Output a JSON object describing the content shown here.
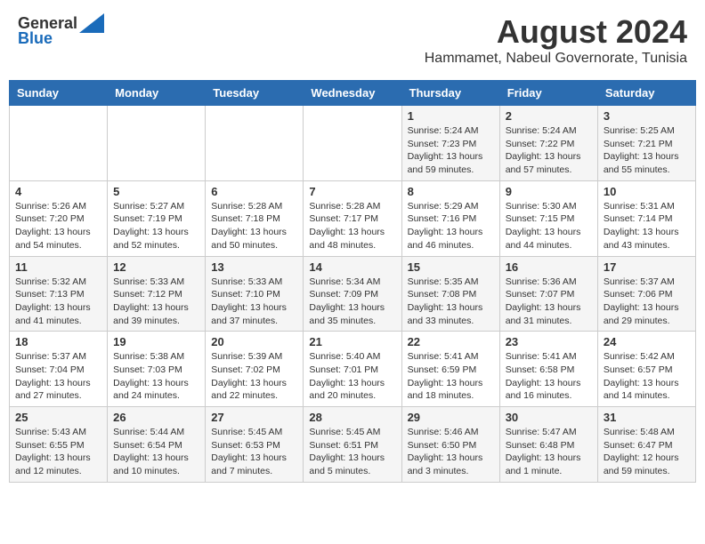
{
  "header": {
    "logo_general": "General",
    "logo_blue": "Blue",
    "month_year": "August 2024",
    "location": "Hammamet, Nabeul Governorate, Tunisia"
  },
  "weekdays": [
    "Sunday",
    "Monday",
    "Tuesday",
    "Wednesday",
    "Thursday",
    "Friday",
    "Saturday"
  ],
  "weeks": [
    [
      {
        "day": "",
        "info": ""
      },
      {
        "day": "",
        "info": ""
      },
      {
        "day": "",
        "info": ""
      },
      {
        "day": "",
        "info": ""
      },
      {
        "day": "1",
        "sunrise": "Sunrise: 5:24 AM",
        "sunset": "Sunset: 7:23 PM",
        "daylight": "Daylight: 13 hours and 59 minutes."
      },
      {
        "day": "2",
        "sunrise": "Sunrise: 5:24 AM",
        "sunset": "Sunset: 7:22 PM",
        "daylight": "Daylight: 13 hours and 57 minutes."
      },
      {
        "day": "3",
        "sunrise": "Sunrise: 5:25 AM",
        "sunset": "Sunset: 7:21 PM",
        "daylight": "Daylight: 13 hours and 55 minutes."
      }
    ],
    [
      {
        "day": "4",
        "sunrise": "Sunrise: 5:26 AM",
        "sunset": "Sunset: 7:20 PM",
        "daylight": "Daylight: 13 hours and 54 minutes."
      },
      {
        "day": "5",
        "sunrise": "Sunrise: 5:27 AM",
        "sunset": "Sunset: 7:19 PM",
        "daylight": "Daylight: 13 hours and 52 minutes."
      },
      {
        "day": "6",
        "sunrise": "Sunrise: 5:28 AM",
        "sunset": "Sunset: 7:18 PM",
        "daylight": "Daylight: 13 hours and 50 minutes."
      },
      {
        "day": "7",
        "sunrise": "Sunrise: 5:28 AM",
        "sunset": "Sunset: 7:17 PM",
        "daylight": "Daylight: 13 hours and 48 minutes."
      },
      {
        "day": "8",
        "sunrise": "Sunrise: 5:29 AM",
        "sunset": "Sunset: 7:16 PM",
        "daylight": "Daylight: 13 hours and 46 minutes."
      },
      {
        "day": "9",
        "sunrise": "Sunrise: 5:30 AM",
        "sunset": "Sunset: 7:15 PM",
        "daylight": "Daylight: 13 hours and 44 minutes."
      },
      {
        "day": "10",
        "sunrise": "Sunrise: 5:31 AM",
        "sunset": "Sunset: 7:14 PM",
        "daylight": "Daylight: 13 hours and 43 minutes."
      }
    ],
    [
      {
        "day": "11",
        "sunrise": "Sunrise: 5:32 AM",
        "sunset": "Sunset: 7:13 PM",
        "daylight": "Daylight: 13 hours and 41 minutes."
      },
      {
        "day": "12",
        "sunrise": "Sunrise: 5:33 AM",
        "sunset": "Sunset: 7:12 PM",
        "daylight": "Daylight: 13 hours and 39 minutes."
      },
      {
        "day": "13",
        "sunrise": "Sunrise: 5:33 AM",
        "sunset": "Sunset: 7:10 PM",
        "daylight": "Daylight: 13 hours and 37 minutes."
      },
      {
        "day": "14",
        "sunrise": "Sunrise: 5:34 AM",
        "sunset": "Sunset: 7:09 PM",
        "daylight": "Daylight: 13 hours and 35 minutes."
      },
      {
        "day": "15",
        "sunrise": "Sunrise: 5:35 AM",
        "sunset": "Sunset: 7:08 PM",
        "daylight": "Daylight: 13 hours and 33 minutes."
      },
      {
        "day": "16",
        "sunrise": "Sunrise: 5:36 AM",
        "sunset": "Sunset: 7:07 PM",
        "daylight": "Daylight: 13 hours and 31 minutes."
      },
      {
        "day": "17",
        "sunrise": "Sunrise: 5:37 AM",
        "sunset": "Sunset: 7:06 PM",
        "daylight": "Daylight: 13 hours and 29 minutes."
      }
    ],
    [
      {
        "day": "18",
        "sunrise": "Sunrise: 5:37 AM",
        "sunset": "Sunset: 7:04 PM",
        "daylight": "Daylight: 13 hours and 27 minutes."
      },
      {
        "day": "19",
        "sunrise": "Sunrise: 5:38 AM",
        "sunset": "Sunset: 7:03 PM",
        "daylight": "Daylight: 13 hours and 24 minutes."
      },
      {
        "day": "20",
        "sunrise": "Sunrise: 5:39 AM",
        "sunset": "Sunset: 7:02 PM",
        "daylight": "Daylight: 13 hours and 22 minutes."
      },
      {
        "day": "21",
        "sunrise": "Sunrise: 5:40 AM",
        "sunset": "Sunset: 7:01 PM",
        "daylight": "Daylight: 13 hours and 20 minutes."
      },
      {
        "day": "22",
        "sunrise": "Sunrise: 5:41 AM",
        "sunset": "Sunset: 6:59 PM",
        "daylight": "Daylight: 13 hours and 18 minutes."
      },
      {
        "day": "23",
        "sunrise": "Sunrise: 5:41 AM",
        "sunset": "Sunset: 6:58 PM",
        "daylight": "Daylight: 13 hours and 16 minutes."
      },
      {
        "day": "24",
        "sunrise": "Sunrise: 5:42 AM",
        "sunset": "Sunset: 6:57 PM",
        "daylight": "Daylight: 13 hours and 14 minutes."
      }
    ],
    [
      {
        "day": "25",
        "sunrise": "Sunrise: 5:43 AM",
        "sunset": "Sunset: 6:55 PM",
        "daylight": "Daylight: 13 hours and 12 minutes."
      },
      {
        "day": "26",
        "sunrise": "Sunrise: 5:44 AM",
        "sunset": "Sunset: 6:54 PM",
        "daylight": "Daylight: 13 hours and 10 minutes."
      },
      {
        "day": "27",
        "sunrise": "Sunrise: 5:45 AM",
        "sunset": "Sunset: 6:53 PM",
        "daylight": "Daylight: 13 hours and 7 minutes."
      },
      {
        "day": "28",
        "sunrise": "Sunrise: 5:45 AM",
        "sunset": "Sunset: 6:51 PM",
        "daylight": "Daylight: 13 hours and 5 minutes."
      },
      {
        "day": "29",
        "sunrise": "Sunrise: 5:46 AM",
        "sunset": "Sunset: 6:50 PM",
        "daylight": "Daylight: 13 hours and 3 minutes."
      },
      {
        "day": "30",
        "sunrise": "Sunrise: 5:47 AM",
        "sunset": "Sunset: 6:48 PM",
        "daylight": "Daylight: 13 hours and 1 minute."
      },
      {
        "day": "31",
        "sunrise": "Sunrise: 5:48 AM",
        "sunset": "Sunset: 6:47 PM",
        "daylight": "Daylight: 12 hours and 59 minutes."
      }
    ]
  ]
}
